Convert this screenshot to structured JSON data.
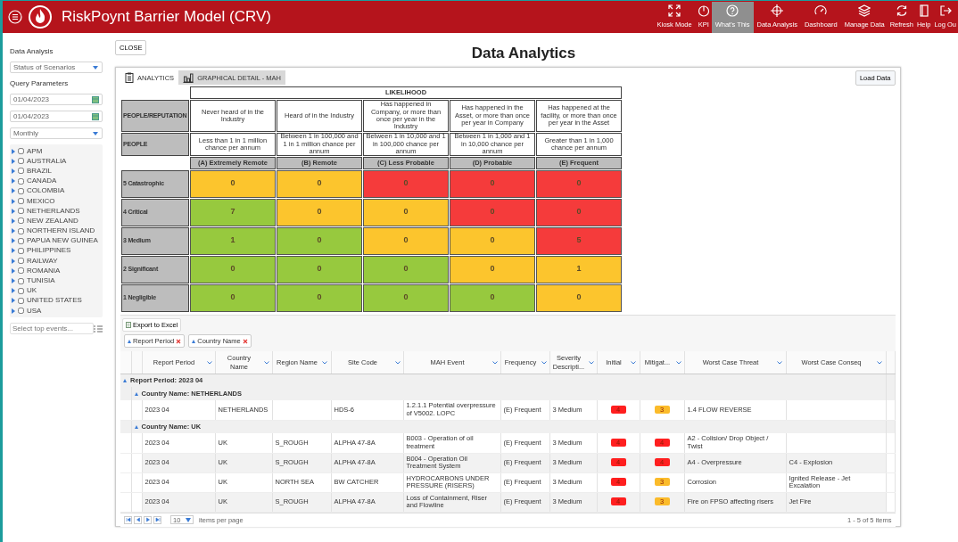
{
  "header": {
    "title": "RiskPoynt Barrier Model (CRV)",
    "nav": [
      {
        "label": "Kiosk Mode",
        "selected": false
      },
      {
        "label": "KPI",
        "selected": false
      },
      {
        "label": "What's This",
        "selected": true
      },
      {
        "label": "Data Analysis",
        "selected": false
      },
      {
        "label": "Dashboard",
        "selected": false
      },
      {
        "label": "Manage Data",
        "selected": false
      },
      {
        "label": "Refresh",
        "selected": false
      },
      {
        "label": "Help",
        "selected": false
      },
      {
        "label": "Log Ou",
        "selected": false
      }
    ]
  },
  "sidebar": {
    "analysis_label": "Data Analysis",
    "analysis_select": "Status of Scenarios",
    "query_label": "Query Parameters",
    "date_from": "01/04/2023",
    "date_to": "01/04/2023",
    "period_select": "Monthly",
    "countries": [
      {
        "label": "APM",
        "checked": false
      },
      {
        "label": "AUSTRALIA",
        "checked": false
      },
      {
        "label": "BRAZIL",
        "checked": false
      },
      {
        "label": "CANADA",
        "checked": false
      },
      {
        "label": "COLOMBIA",
        "checked": false
      },
      {
        "label": "MEXICO",
        "checked": false
      },
      {
        "label": "NETHERLANDS",
        "checked": false
      },
      {
        "label": "NEW ZEALAND",
        "checked": false
      },
      {
        "label": "NORTHERN ISLAND",
        "checked": false
      },
      {
        "label": "PAPUA NEW GUINEA",
        "checked": false
      },
      {
        "label": "PHILIPPINES",
        "checked": false
      },
      {
        "label": "RAILWAY",
        "checked": false
      },
      {
        "label": "ROMANIA",
        "checked": false
      },
      {
        "label": "TUNISIA",
        "checked": false
      },
      {
        "label": "UK",
        "checked": false
      },
      {
        "label": "UNITED STATES",
        "checked": false
      },
      {
        "label": "USA",
        "checked": false
      }
    ],
    "top_events": {
      "placeholder": "Select top events..."
    }
  },
  "close_button": "CLOSE",
  "page_title": "Data Analytics",
  "tabs": [
    {
      "label": "ANALYTICS",
      "selected": true
    },
    {
      "label": "GRAPHICAL DETAIL - MAH",
      "selected": false
    }
  ],
  "load_button": "Load Data",
  "matrix": {
    "title": "LIKELIHOOD",
    "row_labels": [
      "PEOPLE/REPUTATION",
      "PEOPLE"
    ],
    "descriptions": [
      "Never heard of in the Industry",
      "Heard of in the Industry",
      "Has happened in Company, or more than once per year in the Industry",
      "Has happened in the Asset, or more than once per year in Company",
      "Has happened at the facility, or more than once per year in the Asset"
    ],
    "probabilities": [
      "Less than 1 in 1 million chance per annum",
      "Between 1 in 100,000 and 1 in 1 million chance per annum",
      "Between 1 in 10,000 and 1 in 100,000 chance per annum",
      "Between 1 in 1,000 and 1 in 10,000 chance per annum",
      "Greater than 1 in 1,000 chance per annum"
    ],
    "categories": [
      "(A) Extremely Remote",
      "(B) Remote",
      "(C) Less Probable",
      "(D) Probable",
      "(E) Frequent"
    ],
    "severities": [
      {
        "label": "5 Catastrophic",
        "cells": [
          {
            "value": "0",
            "color": "#fcc52d"
          },
          {
            "value": "0",
            "color": "#fcc52d"
          },
          {
            "value": "0",
            "color": "#f53b3b"
          },
          {
            "value": "0",
            "color": "#f53b3b"
          },
          {
            "value": "0",
            "color": "#f53b3b"
          }
        ]
      },
      {
        "label": "4 Critical",
        "cells": [
          {
            "value": "7",
            "color": "#97c93e"
          },
          {
            "value": "0",
            "color": "#fcc52d"
          },
          {
            "value": "0",
            "color": "#fcc52d"
          },
          {
            "value": "0",
            "color": "#f53b3b"
          },
          {
            "value": "0",
            "color": "#f53b3b"
          }
        ]
      },
      {
        "label": "3 Medium",
        "cells": [
          {
            "value": "1",
            "color": "#97c93e"
          },
          {
            "value": "0",
            "color": "#97c93e"
          },
          {
            "value": "0",
            "color": "#fcc52d"
          },
          {
            "value": "0",
            "color": "#fcc52d"
          },
          {
            "value": "5",
            "color": "#f53b3b"
          }
        ]
      },
      {
        "label": "2 Significant",
        "cells": [
          {
            "value": "0",
            "color": "#97c93e"
          },
          {
            "value": "0",
            "color": "#97c93e"
          },
          {
            "value": "0",
            "color": "#97c93e"
          },
          {
            "value": "0",
            "color": "#fcc52d"
          },
          {
            "value": "1",
            "color": "#fcc52d"
          }
        ]
      },
      {
        "label": "1 Negligible",
        "cells": [
          {
            "value": "0",
            "color": "#97c93e"
          },
          {
            "value": "0",
            "color": "#97c93e"
          },
          {
            "value": "0",
            "color": "#97c93e"
          },
          {
            "value": "0",
            "color": "#97c93e"
          },
          {
            "value": "0",
            "color": "#fcc52d"
          }
        ]
      }
    ]
  },
  "grid": {
    "export_button": "Export to Excel",
    "group_chips": [
      "Report Period",
      "Country Name"
    ],
    "columns": [
      "Report Period",
      "Country Name",
      "Region Name",
      "Site Code",
      "MAH Event",
      "Frequency",
      "Severity Descripti...",
      "Initial",
      "Mitigat...",
      "Worst Case Threat",
      "Worst Case Conseq"
    ],
    "group_title": "Report Period: 2023 04",
    "country_groups": [
      {
        "title": "Country Name: NETHERLANDS",
        "rows": [
          {
            "report_period": "2023 04",
            "country": "NETHERLANDS",
            "site": "HDS-6",
            "event": "1.2.1.1 Potential overpressure of V5002. LOPC",
            "frequency": "(E) Frequent",
            "severity": "3 Medium",
            "initial": {
              "value": "4",
              "color": "#ff1f1f"
            },
            "mitigated": {
              "value": "3",
              "color": "#fbbb2a"
            },
            "threat": "1.4 FLOW REVERSE"
          }
        ]
      },
      {
        "title": "Country Name: UK",
        "rows": [
          {
            "report_period": "2023 04",
            "country": "UK",
            "region": "S_ROUGH",
            "site": "ALPHA 47-8A",
            "event": "B003 - Operation of oil treatment",
            "frequency": "(E) Frequent",
            "severity": "3 Medium",
            "initial": {
              "value": "4",
              "color": "#ff1f1f"
            },
            "mitigated": {
              "value": "4",
              "color": "#ff1f1f"
            },
            "threat": "A2 - Colision/ Drop Object / Twist"
          },
          {
            "report_period": "2023 04",
            "country": "UK",
            "region": "S_ROUGH",
            "site": "ALPHA 47-8A",
            "event": "B004 - Operation Oil Treatment System",
            "frequency": "(E) Frequent",
            "severity": "3 Medium",
            "initial": {
              "value": "4",
              "color": "#ff1f1f"
            },
            "mitigated": {
              "value": "4",
              "color": "#ff1f1f"
            },
            "threat": "A4 - Overpressure",
            "consequence": "C4 - Explosion"
          },
          {
            "report_period": "2023 04",
            "country": "UK",
            "region": "NORTH SEA",
            "site": "BW CATCHER",
            "event": "HYDROCARBONS UNDER PRESSURE (RISERS)",
            "frequency": "(E) Frequent",
            "severity": "3 Medium",
            "initial": {
              "value": "4",
              "color": "#ff1f1f"
            },
            "mitigated": {
              "value": "3",
              "color": "#fbbb2a"
            },
            "threat": "Corrosion",
            "consequence": "Ignited Release - Jet Excalation"
          },
          {
            "report_period": "2023 04",
            "country": "UK",
            "region": "S_ROUGH",
            "site": "ALPHA 47-8A",
            "event": "Loss of Containment, Riser and Flowline",
            "frequency": "(E) Frequent",
            "severity": "3 Medium",
            "initial": {
              "value": "4",
              "color": "#ff1f1f"
            },
            "mitigated": {
              "value": "3",
              "color": "#fbbb2a"
            },
            "threat": "Fire on FPSO affecting risers",
            "consequence": "Jet Fire"
          }
        ]
      }
    ],
    "pager": {
      "page_size": "10",
      "items_label": "items per page",
      "summary": "1 - 5 of 5 items"
    }
  }
}
